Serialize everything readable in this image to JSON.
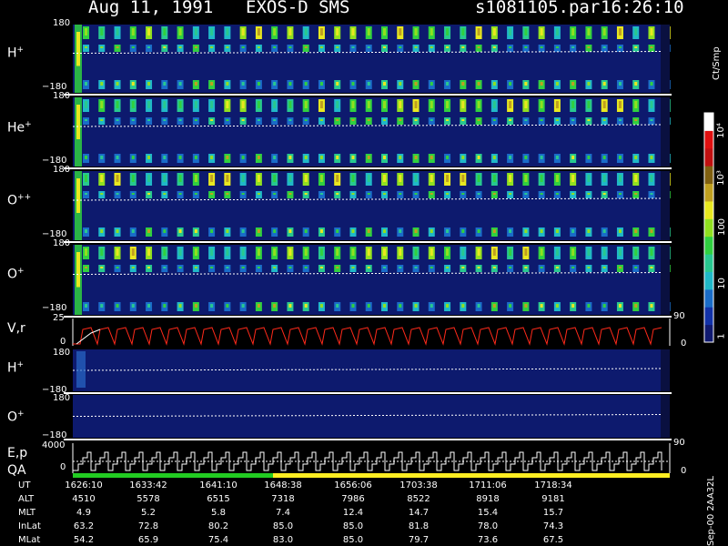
{
  "header": {
    "date": "Aug 11, 1991",
    "instrument": "EXOS-D SMS",
    "file": "s1081105.par",
    "time": "16:26:10"
  },
  "colors": {
    "background": "#000000",
    "plot_bg": "#0d1a6e",
    "separator": "#ffffff",
    "vr_trace": "#ff2a1a",
    "qa_green": "#22cc22",
    "qa_yellow": "#ffee22"
  },
  "colorbar": {
    "unit": "Ct/Smp",
    "ticks": [
      "1",
      "10",
      "100",
      "10³",
      "10⁴"
    ],
    "colors": [
      "#101a70",
      "#1232a8",
      "#1a6cc8",
      "#20b8c8",
      "#28c890",
      "#30d040",
      "#90e020",
      "#e8e820",
      "#c0a020",
      "#806010",
      "#c01010",
      "#e01010",
      "#ffffff"
    ]
  },
  "panels": [
    {
      "label": "H",
      "charge": "+",
      "top_tick": "180",
      "bottom_tick": "−180"
    },
    {
      "label": "He",
      "charge": "+",
      "top_tick": "180",
      "bottom_tick": "−180"
    },
    {
      "label": "O",
      "charge": "++",
      "top_tick": "180",
      "bottom_tick": "−180"
    },
    {
      "label": "O",
      "charge": "+",
      "top_tick": "180",
      "bottom_tick": "−180"
    }
  ],
  "vr_panel": {
    "label": "V,r",
    "left_ticks": [
      "25",
      "0"
    ],
    "right_ticks": [
      "90",
      "0"
    ]
  },
  "lower_panels": [
    {
      "label": "H",
      "charge": "+",
      "top_tick": "180",
      "bottom_tick": "−180"
    },
    {
      "label": "O",
      "charge": "+",
      "top_tick": "180",
      "bottom_tick": "−180"
    }
  ],
  "ep_panel": {
    "label": "E,p",
    "qa_label": "QA",
    "left_ticks": [
      "4000",
      "0"
    ],
    "right_ticks": [
      "90",
      "0"
    ]
  },
  "footer": {
    "side_note": "Sep-00  2AA32L",
    "rows": [
      {
        "name": "UT",
        "values": [
          "1626:10",
          "1633:42",
          "1641:10",
          "1648:38",
          "1656:06",
          "1703:38",
          "1711:06",
          "1718:34"
        ]
      },
      {
        "name": "ALT",
        "values": [
          "4510",
          "5578",
          "6515",
          "7318",
          "7986",
          "8522",
          "8918",
          "9181"
        ]
      },
      {
        "name": "MLT",
        "values": [
          "4.9",
          "5.2",
          "5.8",
          "7.4",
          "12.4",
          "14.7",
          "15.4",
          "15.7"
        ]
      },
      {
        "name": "InLat",
        "values": [
          "63.2",
          "72.8",
          "80.2",
          "85.0",
          "85.0",
          "81.8",
          "78.0",
          "74.3"
        ]
      },
      {
        "name": "MLat",
        "values": [
          "54.2",
          "65.9",
          "75.4",
          "83.0",
          "85.0",
          "79.7",
          "73.6",
          "67.5"
        ]
      }
    ]
  },
  "chart_data": {
    "type": "heatmap",
    "title": "Aug 11, 1991   EXOS-D SMS",
    "xlabel": "UT",
    "x": [
      "1626:10",
      "1633:42",
      "1641:10",
      "1648:38",
      "1656:06",
      "1703:38",
      "1711:06",
      "1718:34"
    ],
    "ylim": [
      -180,
      180
    ],
    "series": [
      {
        "name": "H+",
        "ylim": [
          -180,
          180
        ]
      },
      {
        "name": "He+",
        "ylim": [
          -180,
          180
        ]
      },
      {
        "name": "O++",
        "ylim": [
          -180,
          180
        ]
      },
      {
        "name": "O+",
        "ylim": [
          -180,
          180
        ]
      }
    ],
    "colorbar_label": "Ct/Smp",
    "colorbar_ticks": [
      "1",
      "10",
      "100",
      "10³",
      "10⁴"
    ],
    "grid": false
  }
}
